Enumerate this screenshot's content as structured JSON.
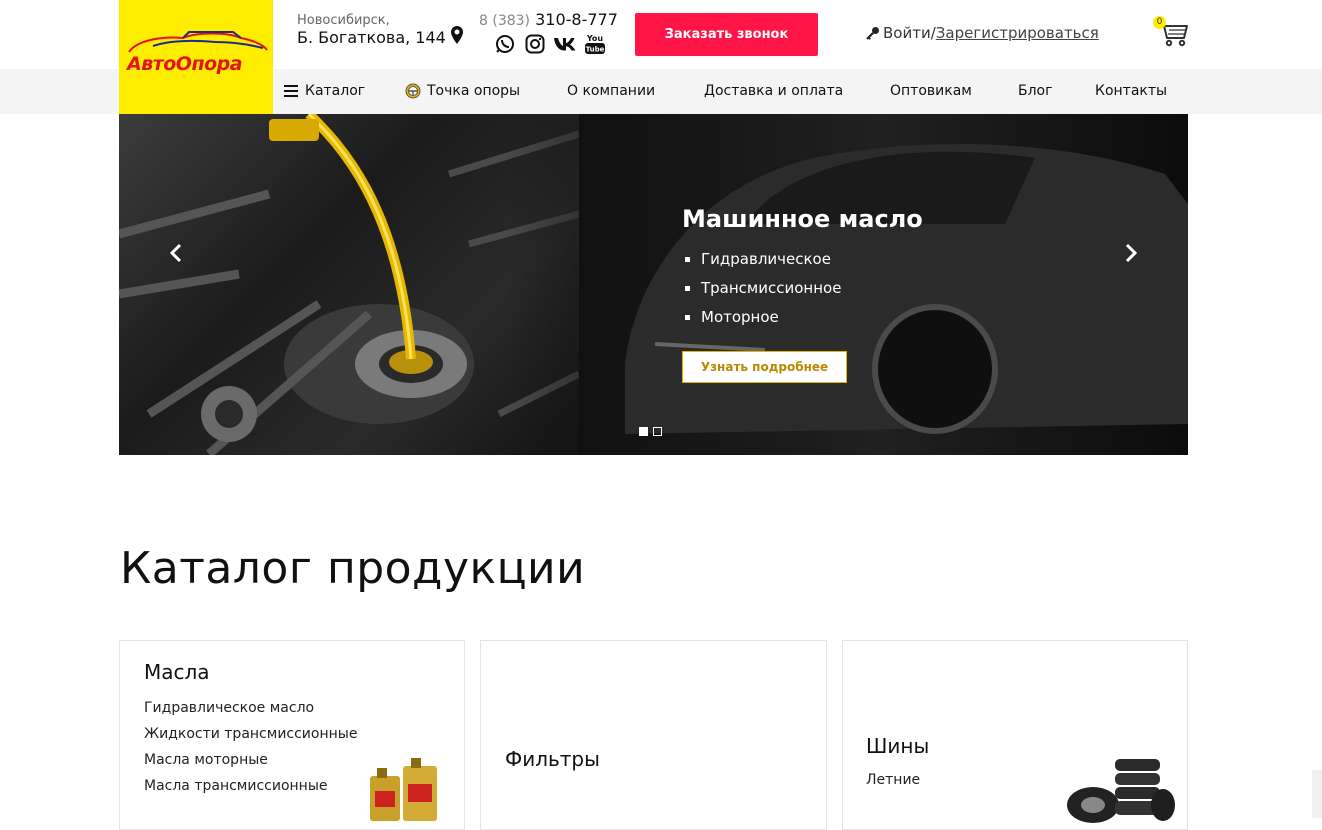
{
  "header": {
    "logo_text": "АвтоОпора",
    "address_city": "Новосибирск,",
    "address_street": "Б. Богаткова, 144",
    "phone_code": "8 (383)",
    "phone_number": "310-8-777",
    "socials": [
      "viber-icon",
      "instagram-icon",
      "vk-icon",
      "youtube-icon"
    ],
    "callback_label": "Заказать звонок",
    "login_label": "Войти",
    "separator": "/",
    "register_label": "Зарегистрироваться",
    "cart_count": "0"
  },
  "nav": {
    "items": [
      {
        "label": "Каталог",
        "icon": "menu-icon"
      },
      {
        "label": "Точка опоры",
        "icon": "steering-wheel-icon"
      },
      {
        "label": "О компании"
      },
      {
        "label": "Доставка и оплата"
      },
      {
        "label": "Оптовикам"
      },
      {
        "label": "Блог"
      },
      {
        "label": "Контакты"
      }
    ]
  },
  "hero": {
    "title": "Машинное масло",
    "bullets": [
      "Гидравлическое",
      "Трансмиссионное",
      "Моторное"
    ],
    "button_label": "Узнать подробнее",
    "slide_count": 2,
    "active_slide": 1
  },
  "catalog": {
    "title": "Каталог продукции",
    "cards": [
      {
        "title": "Масла",
        "links": [
          "Гидравлическое масло",
          "Жидкости трансмиссионные",
          "Масла моторные",
          "Масла трансмиссионные"
        ]
      },
      {
        "title": "Фильтры",
        "links": []
      },
      {
        "title": "Шины",
        "links": [
          "Летние"
        ]
      }
    ]
  },
  "colors": {
    "brand_yellow": "#ffed00",
    "brand_red": "#e3141a",
    "callback_red": "#ff1547",
    "accent_gold": "#e5b300"
  }
}
